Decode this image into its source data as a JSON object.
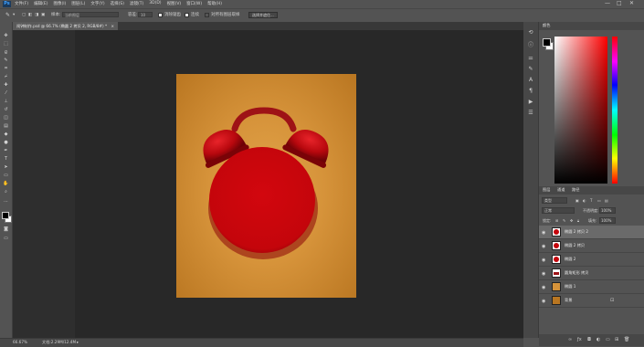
{
  "app": {
    "logo": "Ps"
  },
  "menubar": {
    "items": [
      "文件(F)",
      "编辑(E)",
      "图像(I)",
      "图层(L)",
      "文字(Y)",
      "选择(S)",
      "滤镜(T)",
      "3D(D)",
      "视图(V)",
      "窗口(W)",
      "帮助(H)"
    ],
    "min": "—",
    "max": "□",
    "close": "✕"
  },
  "options": {
    "sample_label": "样本:",
    "sample_value": "当前图层",
    "tolerance_label": "容差:",
    "tolerance_value": "10",
    "antialias_label": "消除锯齿",
    "contiguous_label": "连续",
    "sample_all_label": "对所有图层取样",
    "refine_label": "选择并遮住..."
  },
  "document": {
    "tab_label": "闹钟制作.psd @ 66.7% (椭圆 2 拷贝 2, RGB/8#) *",
    "close": "×"
  },
  "status": {
    "zoom": "66.67%",
    "doc_info": "文档:2.29M/12.4M"
  },
  "color_panel": {
    "title": "颜色",
    "fg": "#000000",
    "bg": "#ffffff"
  },
  "layers_panel": {
    "tabs": [
      "图层",
      "通道",
      "路径"
    ],
    "filter_label": "类型",
    "blend_mode": "正常",
    "opacity_label": "不透明度:",
    "opacity_value": "100%",
    "lock_label": "锁定:",
    "fill_label": "填充:",
    "fill_value": "100%",
    "layers": [
      {
        "name": "椭圆 2 拷贝 2",
        "selected": true
      },
      {
        "name": "椭圆 2 拷贝",
        "selected": false
      },
      {
        "name": "椭圆 2",
        "selected": false
      },
      {
        "name": "圆角矩形 拷贝",
        "selected": false
      },
      {
        "name": "椭圆 1",
        "selected": false
      },
      {
        "name": "背景",
        "selected": false,
        "locked": true
      }
    ]
  },
  "colors": {
    "clock_red": "#c9060c",
    "bg_orange": "#d6933a"
  }
}
